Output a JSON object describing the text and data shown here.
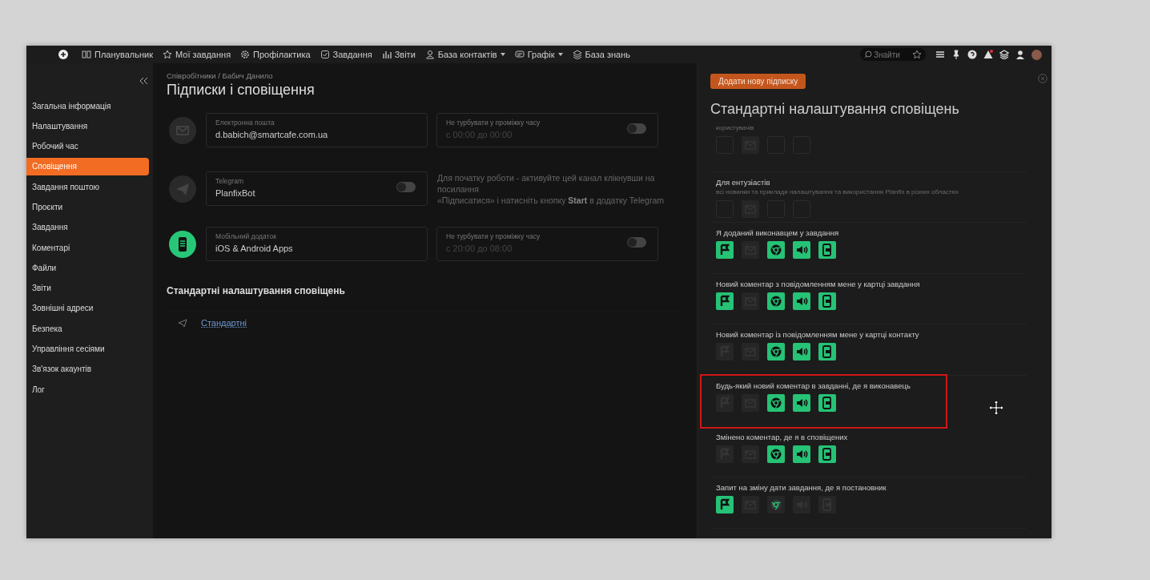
{
  "nav": {
    "items": [
      {
        "label": "Планувальник",
        "dropdown": false
      },
      {
        "label": "Мої завдання",
        "dropdown": false
      },
      {
        "label": "Профілактика",
        "dropdown": false
      },
      {
        "label": "Завдання",
        "dropdown": false
      },
      {
        "label": "Звіти",
        "dropdown": false
      },
      {
        "label": "База контактів",
        "dropdown": true
      },
      {
        "label": "Графік",
        "dropdown": true
      },
      {
        "label": "База знань",
        "dropdown": false
      }
    ],
    "search": {
      "placeholder": "Знайти"
    }
  },
  "sidebar": {
    "items": [
      {
        "label": "Загальна інформація",
        "selected": false
      },
      {
        "label": "Налаштування",
        "selected": false
      },
      {
        "label": "Робочий час",
        "selected": false
      },
      {
        "label": "Сповіщення",
        "selected": true
      },
      {
        "label": "Завдання поштою",
        "selected": false
      },
      {
        "label": "Проєкти",
        "selected": false
      },
      {
        "label": "Завдання",
        "selected": false
      },
      {
        "label": "Коментарі",
        "selected": false
      },
      {
        "label": "Файли",
        "selected": false
      },
      {
        "label": "Звіти",
        "selected": false
      },
      {
        "label": "Зовнішні адреси",
        "selected": false
      },
      {
        "label": "Безпека",
        "selected": false
      },
      {
        "label": "Управління сесіями",
        "selected": false
      },
      {
        "label": "Зв'язок акаунтів",
        "selected": false
      },
      {
        "label": "Лог",
        "selected": false
      }
    ]
  },
  "main": {
    "breadcrumb": "Співробітники / Бабич Данило",
    "title": "Підписки і сповіщення",
    "channels": [
      {
        "kind": "email",
        "active": false,
        "label": "Електронна пошта",
        "value": "d.babich@smartcafe.com.ua",
        "side": {
          "kind": "dnd",
          "label": "Не турбувати у проміжку часу",
          "value": "с 00:00  до 00:00",
          "on": false
        }
      },
      {
        "kind": "telegram",
        "active": false,
        "label": "Telegram",
        "value": "PlanfixBot",
        "toggle": {
          "on": false
        },
        "side": {
          "kind": "note",
          "text": "Для початку роботи - активуйте цей канал клікнувши на посилання\n«Підписатися» і натисніть кнопку **Start** в додатку Telegram"
        }
      },
      {
        "kind": "mobile",
        "active": true,
        "label": "Мобільний додаток",
        "value": "iOS & Android Apps",
        "side": {
          "kind": "dnd",
          "label": "Не турбувати у проміжку часу",
          "value": "с 20:00  до 08:00",
          "on": false
        }
      }
    ],
    "section_title": "Стандартні налаштування сповіщень",
    "link": "Стандартні"
  },
  "panel": {
    "button": "Додати нову підписку",
    "title": "Стандартні налаштування сповіщень",
    "rows": [
      {
        "title": null,
        "description": "користувачів",
        "highlighted": false,
        "channels": [
          {
            "kind": "blank",
            "on": false
          },
          {
            "kind": "mail",
            "on": false
          },
          {
            "kind": "blank",
            "on": false
          },
          {
            "kind": "blank",
            "on": false
          }
        ]
      },
      {
        "title": "Для ентузіастів",
        "description": "всі новинки та приклади налаштування та використання Planfix в різних областях",
        "highlighted": false,
        "channels": [
          {
            "kind": "blank",
            "on": false
          },
          {
            "kind": "mail",
            "on": false
          },
          {
            "kind": "blank",
            "on": false
          },
          {
            "kind": "blank",
            "on": false
          }
        ]
      },
      {
        "title": "Я доданий виконавцем у завдання",
        "description": null,
        "highlighted": false,
        "channels": [
          {
            "kind": "flag",
            "on": true
          },
          {
            "kind": "mail",
            "on": false
          },
          {
            "kind": "browser",
            "on": true
          },
          {
            "kind": "sound",
            "on": true
          },
          {
            "kind": "mobile",
            "on": true
          }
        ]
      },
      {
        "title": "Новий коментар з повідомленням мене у картці завдання",
        "description": null,
        "highlighted": false,
        "channels": [
          {
            "kind": "flag",
            "on": true
          },
          {
            "kind": "mail",
            "on": false
          },
          {
            "kind": "browser",
            "on": true
          },
          {
            "kind": "sound",
            "on": true
          },
          {
            "kind": "mobile",
            "on": true
          }
        ]
      },
      {
        "title": "Новий коментар із повідомленням мене у картці контакту",
        "description": null,
        "highlighted": false,
        "channels": [
          {
            "kind": "flag",
            "on": false
          },
          {
            "kind": "mail",
            "on": false
          },
          {
            "kind": "browser",
            "on": true
          },
          {
            "kind": "sound",
            "on": true
          },
          {
            "kind": "mobile",
            "on": true
          }
        ]
      },
      {
        "title": "Будь-який новий коментар в завданні, де я виконавець",
        "description": null,
        "highlighted": true,
        "channels": [
          {
            "kind": "flag",
            "on": false
          },
          {
            "kind": "mail",
            "on": false
          },
          {
            "kind": "browser",
            "on": true
          },
          {
            "kind": "sound",
            "on": true
          },
          {
            "kind": "mobile",
            "on": true
          }
        ]
      },
      {
        "title": "Змінено коментар, де я в сповіщених",
        "description": null,
        "highlighted": false,
        "channels": [
          {
            "kind": "flag",
            "on": false
          },
          {
            "kind": "mail",
            "on": false
          },
          {
            "kind": "browser",
            "on": true
          },
          {
            "kind": "sound",
            "on": true
          },
          {
            "kind": "mobile",
            "on": true
          }
        ]
      },
      {
        "title": "Запит на зміну дати завдання, де я постановник",
        "description": null,
        "highlighted": false,
        "channels": [
          {
            "kind": "flag",
            "on": true
          },
          {
            "kind": "mail",
            "on": false
          },
          {
            "kind": "browser",
            "on": false
          },
          {
            "kind": "sound",
            "on": false
          },
          {
            "kind": "mobile",
            "on": false
          }
        ]
      }
    ]
  }
}
